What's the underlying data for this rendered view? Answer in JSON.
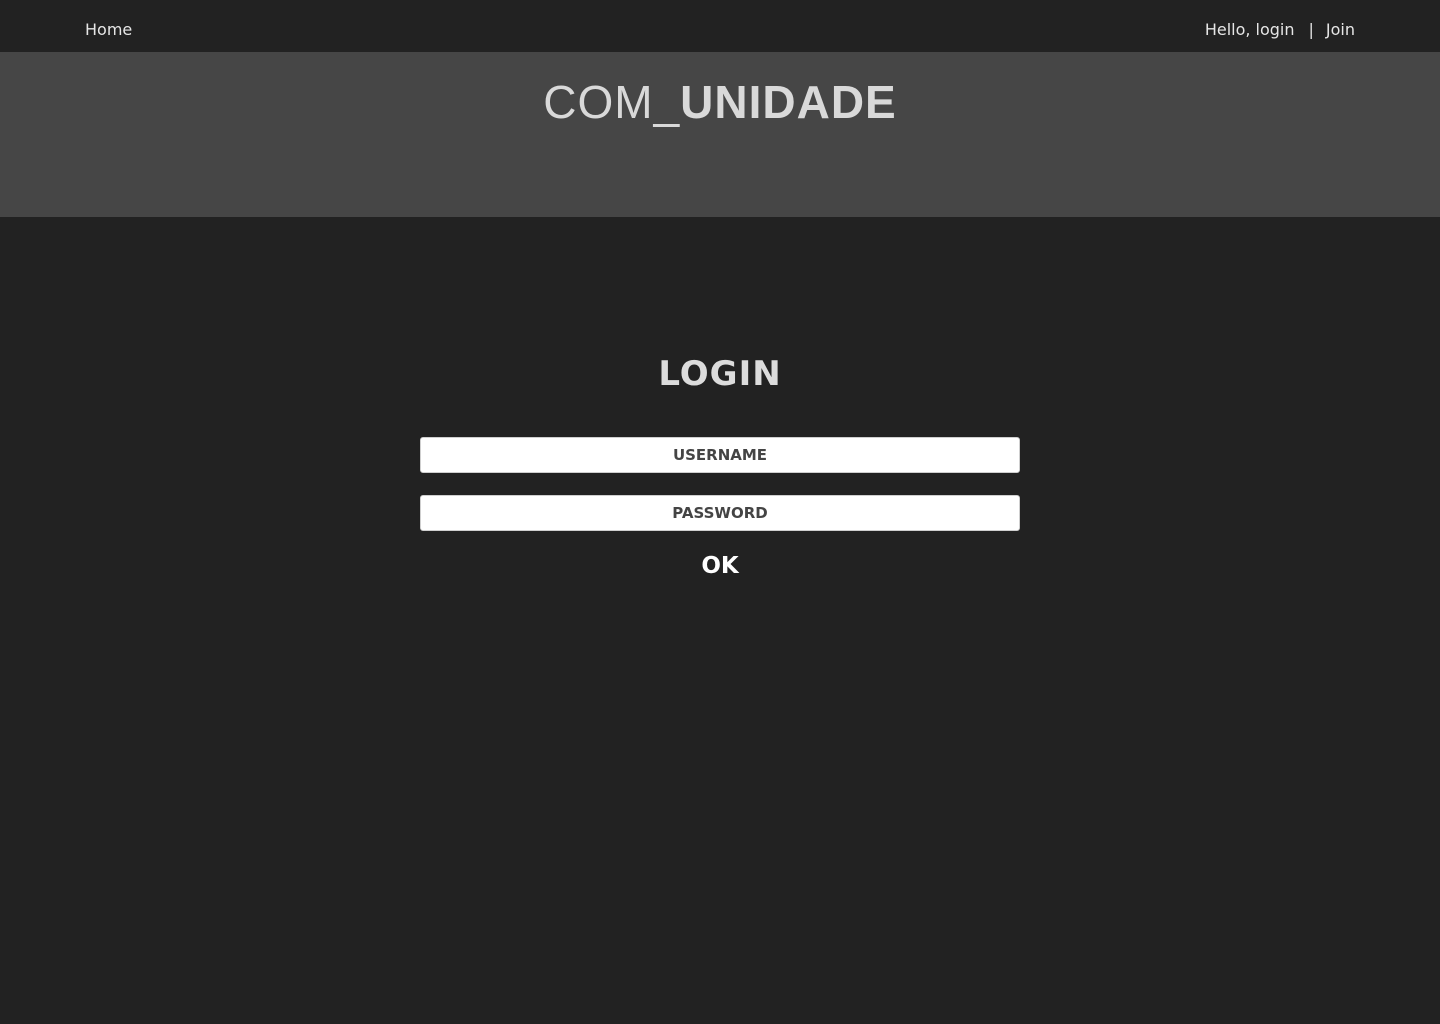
{
  "nav": {
    "home_label": "Home",
    "greeting_label": "Hello, login",
    "separator": "|",
    "join_label": "Join"
  },
  "brand": {
    "prefix": "COM_",
    "name": "UNIDADE"
  },
  "login": {
    "title": "LOGIN",
    "username_placeholder": "USERNAME",
    "password_placeholder": "PASSWORD",
    "submit_label": "OK"
  },
  "colors": {
    "page_background": "#222222",
    "banner_background": "#464646",
    "text_light": "#e6e6e6",
    "input_background": "#ffffff"
  }
}
